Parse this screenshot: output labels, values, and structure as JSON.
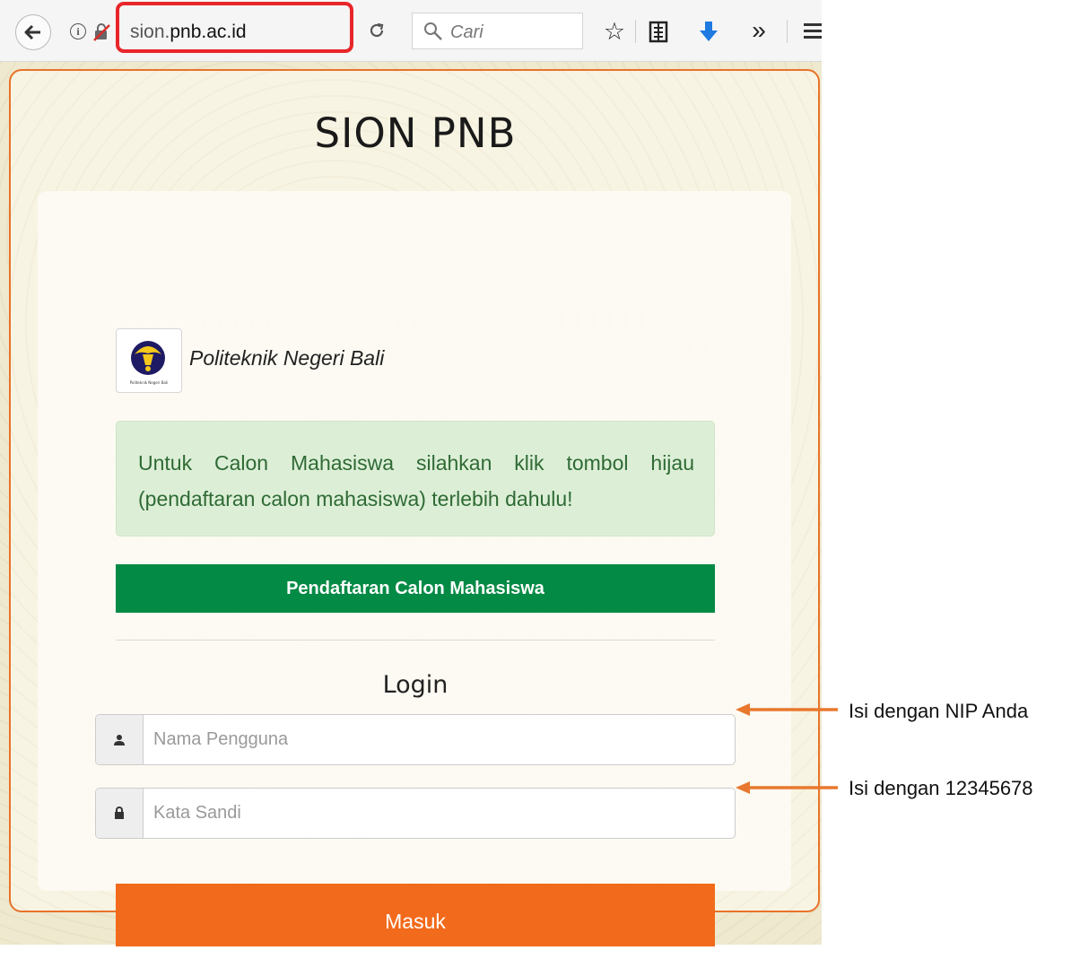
{
  "browser": {
    "url_prefix": "sion.",
    "url_host": "pnb.ac.id",
    "search_placeholder": "Cari",
    "icons": [
      "back-arrow-icon",
      "info-icon",
      "insecure-lock-icon",
      "reload-icon",
      "search-icon",
      "star-icon",
      "reader-list-icon",
      "download-icon",
      "overflow-icon",
      "hamburger-menu-icon"
    ],
    "download_icon_color": "#1e7ae0",
    "highlight_color": "#e8262a"
  },
  "page": {
    "title": "SION PNB",
    "institution": "Politeknik Negeri Bali",
    "logo_caption_small": "Politeknik Negeri Bali",
    "alert_text": "Untuk Calon Mahasiswa silahkan klik tombol hijau (pendaftaran calon mahasiswa) terlebih dahulu!",
    "register_button": "Pendaftaran Calon Mahasiswa",
    "login_heading": "Login",
    "username_placeholder": "Nama Pengguna",
    "password_placeholder": "Kata Sandi",
    "login_button": "Masuk",
    "colors": {
      "card_border": "#e8732a",
      "register_button": "#038a45",
      "login_button": "#f26a1b",
      "alert_background": "#dcefd6",
      "alert_text": "#2f6a35"
    }
  },
  "annotations": {
    "username_note": "Isi dengan NIP Anda",
    "password_note": "Isi dengan 12345678",
    "arrow_color": "#e8782e"
  }
}
